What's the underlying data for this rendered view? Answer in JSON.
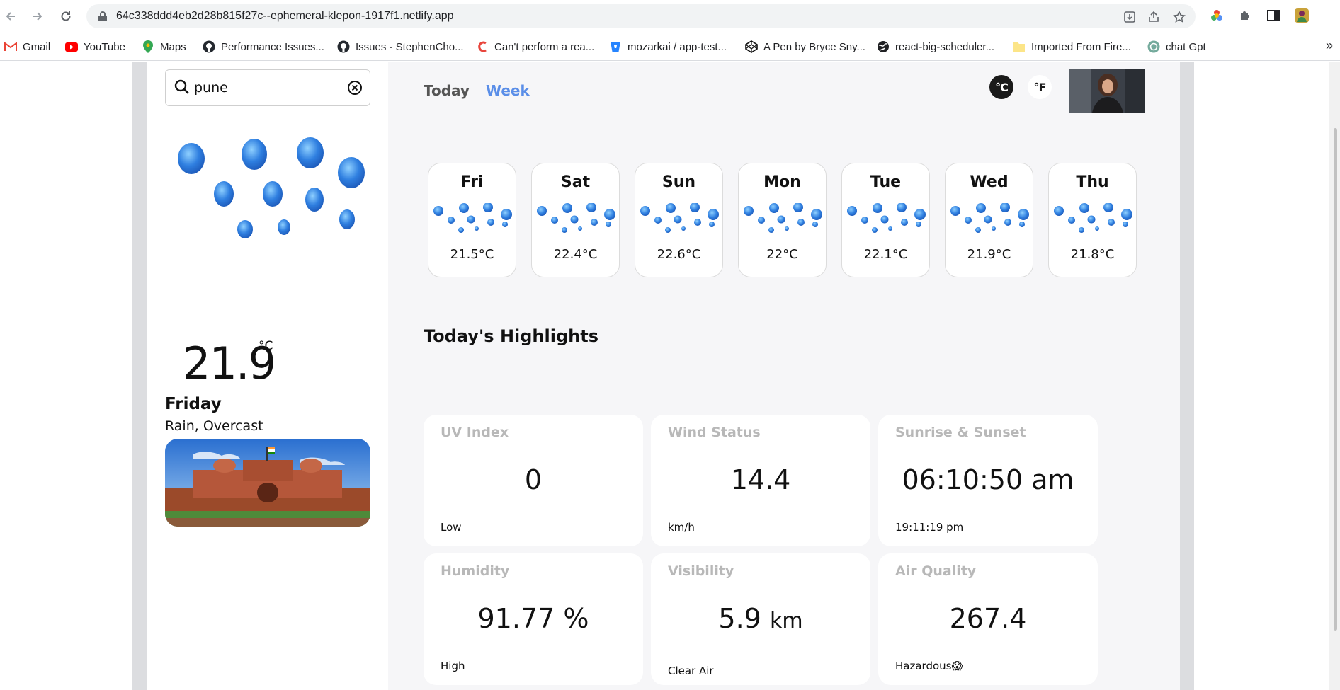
{
  "browser": {
    "url": "64c338ddd4eb2d28b815f27c--ephemeral-klepon-1917f1.netlify.app",
    "bookmarks": [
      {
        "label": "Gmail",
        "icon": "gmail-icon"
      },
      {
        "label": "YouTube",
        "icon": "youtube-icon"
      },
      {
        "label": "Maps",
        "icon": "maps-icon"
      },
      {
        "label": "Performance Issues...",
        "icon": "github-icon"
      },
      {
        "label": "Issues · StephenCho...",
        "icon": "github-icon"
      },
      {
        "label": "Can't perform a rea...",
        "icon": "codecademy-icon"
      },
      {
        "label": "mozarkai / app-test...",
        "icon": "bitbucket-icon"
      },
      {
        "label": "A Pen by Bryce Sny...",
        "icon": "codepen-icon"
      },
      {
        "label": "react-big-scheduler...",
        "icon": "globe-icon"
      },
      {
        "label": "Imported From Fire...",
        "icon": "folder-icon"
      },
      {
        "label": "chat Gpt",
        "icon": "chatgpt-icon"
      }
    ],
    "more_bookmarks": "»"
  },
  "sidebar": {
    "search_value": "pune",
    "temperature": "21.9",
    "temperature_unit": "°C",
    "day": "Friday",
    "condition": "Rain, Overcast"
  },
  "main": {
    "tabs": [
      "Today",
      "Week"
    ],
    "active_tab": "Week",
    "units": [
      "°C",
      "°F"
    ],
    "active_unit": "°C",
    "forecast": [
      {
        "day": "Fri",
        "temp": "21.5°C"
      },
      {
        "day": "Sat",
        "temp": "22.4°C"
      },
      {
        "day": "Sun",
        "temp": "22.6°C"
      },
      {
        "day": "Mon",
        "temp": "22°C"
      },
      {
        "day": "Tue",
        "temp": "22.1°C"
      },
      {
        "day": "Wed",
        "temp": "21.9°C"
      },
      {
        "day": "Thu",
        "temp": "21.8°C"
      }
    ],
    "highlights_title": "Today's Highlights",
    "highlights": {
      "uv": {
        "title": "UV Index",
        "value": "0",
        "sub": "Low"
      },
      "wind": {
        "title": "Wind Status",
        "value": "14.4",
        "sub": "km/h"
      },
      "sun": {
        "title": "Sunrise & Sunset",
        "value": "06:10:50 am",
        "sub": "19:11:19 pm"
      },
      "humidity": {
        "title": "Humidity",
        "value": "91.77 %",
        "sub": "High"
      },
      "visibility": {
        "title": "Visibility",
        "value": "5.9",
        "unit": "km",
        "sub": "Clear Air"
      },
      "air": {
        "title": "Air Quality",
        "value": "267.4",
        "sub": "Hazardous😱"
      }
    }
  },
  "colors": {
    "accent": "#5a8ee8",
    "main_bg": "#f6f6f8",
    "card_title": "#b8b8b8",
    "raindrop": "#2f7fe0"
  }
}
